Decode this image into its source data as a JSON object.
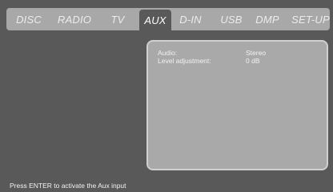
{
  "tabs": [
    {
      "label": "DISC",
      "active": false
    },
    {
      "label": "RADIO",
      "active": false
    },
    {
      "label": "TV",
      "active": false
    },
    {
      "label": "AUX",
      "active": true
    },
    {
      "label": "D-IN",
      "active": false
    },
    {
      "label": "USB",
      "active": false
    },
    {
      "label": "DMP",
      "active": false
    },
    {
      "label": "SET-UP",
      "active": false
    }
  ],
  "info": {
    "rows": [
      {
        "label": "Audio:",
        "value": "Stereo"
      },
      {
        "label": "Level adjustment:",
        "value": "0 dB"
      }
    ]
  },
  "status": {
    "text": "Press ENTER to activate the Aux input"
  }
}
